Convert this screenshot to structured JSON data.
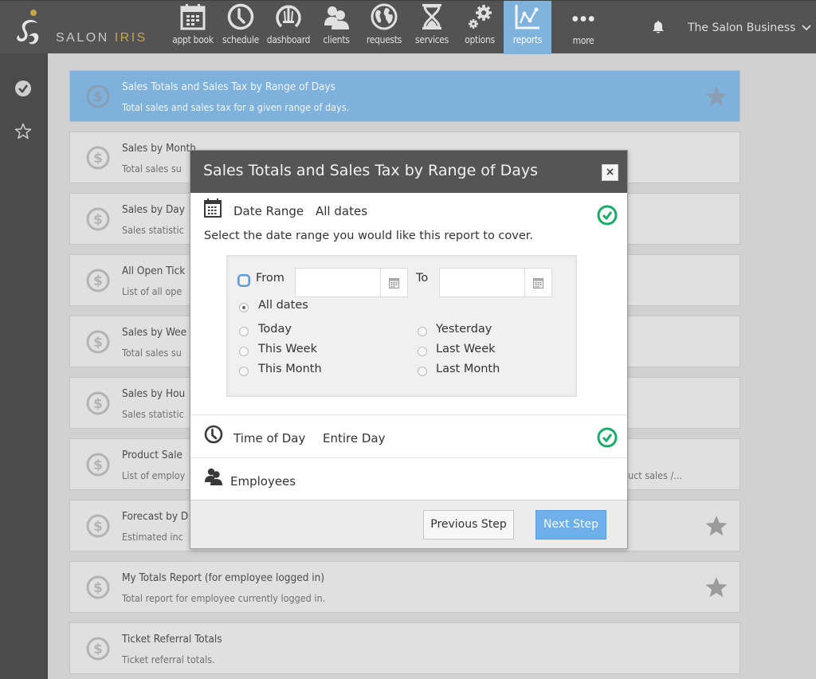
{
  "app": {
    "logo_text_main": "SALON ",
    "logo_text_accent": "IRIS",
    "brand_accent_color": "#c5a54a",
    "account_name": "The Salon Business"
  },
  "nav": {
    "items": [
      {
        "label": "appt book",
        "icon": "calendar-icon"
      },
      {
        "label": "schedule",
        "icon": "clock-icon"
      },
      {
        "label": "dashboard",
        "icon": "gauge-icon"
      },
      {
        "label": "clients",
        "icon": "people-icon"
      },
      {
        "label": "requests",
        "icon": "globe-icon"
      },
      {
        "label": "services",
        "icon": "hourglass-icon"
      },
      {
        "label": "options",
        "icon": "gears-icon"
      },
      {
        "label": "reports",
        "icon": "line-chart-icon",
        "active": true
      },
      {
        "label": "more",
        "icon": "ellipsis-icon"
      }
    ],
    "active_color": "#7fb2dd"
  },
  "sidebar": {
    "items": [
      {
        "icon": "check-circle-icon"
      },
      {
        "icon": "star-outline-icon"
      }
    ]
  },
  "reports": [
    {
      "title": "Sales Totals and Sales Tax by Range of Days",
      "desc": "Total sales and sales tax for a given range of days.",
      "selected": true,
      "favorite": true
    },
    {
      "title": "Sales by Month",
      "desc": "Total sales su",
      "favorite": false
    },
    {
      "title": "Sales by Day",
      "desc": "Sales statistic",
      "favorite": false
    },
    {
      "title": "All Open Tick",
      "desc": "List of all ope",
      "favorite": false
    },
    {
      "title": "Sales by Wee",
      "desc": "Total sales su",
      "favorite": false
    },
    {
      "title": "Sales by Hou",
      "desc": "Sales statistic",
      "favorite": false
    },
    {
      "title": "Product Sale",
      "desc": "List of employ",
      "desc_tail": "uct sales /...",
      "favorite": false
    },
    {
      "title": "Forecast by D",
      "desc": "Estimated inc",
      "favorite": true
    },
    {
      "title": "My Totals Report (for employee logged in)",
      "desc": "Total report for employee currently logged in.",
      "favorite": true
    },
    {
      "title": "Ticket Referral Totals",
      "desc": "Ticket referral totals.",
      "favorite": false
    }
  ],
  "modal": {
    "title": "Sales Totals and Sales Tax by Range of Days",
    "close_label": "×",
    "date_range": {
      "label": "Date Range",
      "value": "All dates",
      "instructions": "Select the date range you would like this report to cover.",
      "from_label": "From",
      "to_label": "To",
      "from_value": "",
      "to_value": "",
      "options": {
        "all_dates": "All dates",
        "today": "Today",
        "yesterday": "Yesterday",
        "this_week": "This Week",
        "last_week": "Last Week",
        "this_month": "This Month",
        "last_month": "Last Month"
      },
      "selected": "All dates",
      "complete": true
    },
    "time_of_day": {
      "label": "Time of Day",
      "value": "Entire Day",
      "complete": true
    },
    "employees": {
      "label": "Employees"
    },
    "buttons": {
      "previous": "Previous Step",
      "next": "Next Step"
    },
    "success_color": "#1aaa6a",
    "primary_color": "#6fb0ea"
  }
}
